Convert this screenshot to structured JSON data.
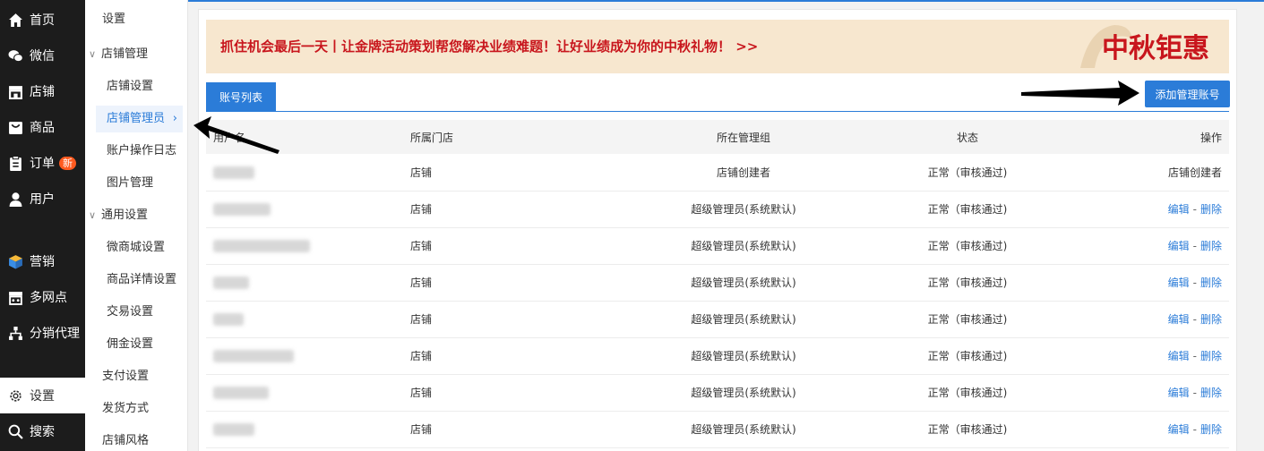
{
  "nav": {
    "home": "首页",
    "wechat": "微信",
    "shop": "店铺",
    "goods": "商品",
    "orders": "订单",
    "orders_badge": "新",
    "users": "用户",
    "marketing": "营销",
    "multi_outlet": "多网点",
    "distribution": "分销代理",
    "settings": "设置",
    "search": "搜索"
  },
  "subnav": {
    "title": "设置",
    "shop_management": "店铺管理",
    "shop_settings": "店铺设置",
    "shop_admins": "店铺管理员",
    "account_log": "账户操作日志",
    "image_management": "图片管理",
    "general_settings": "通用设置",
    "mall_settings": "微商城设置",
    "goods_detail_settings": "商品详情设置",
    "trade_settings": "交易设置",
    "commission_settings": "佣金设置",
    "payment_settings": "支付设置",
    "shipping_methods": "发货方式",
    "shop_style": "店铺风格"
  },
  "banner": {
    "text": "抓住机会最后一天丨让金牌活动策划帮您解决业绩难题！让好业绩成为你的中秋礼物！ >>",
    "art_text": "中秋钜惠"
  },
  "tabs": {
    "active": "账号列表"
  },
  "add_button": "添加管理账号",
  "table": {
    "headers": {
      "name": "用户名",
      "store": "所属门店",
      "group": "所在管理组",
      "status": "状态",
      "action": "操作"
    },
    "rows": [
      {
        "store": "店铺",
        "group": "店铺创建者",
        "status": "正常（审核通过)",
        "action": "店铺创建者"
      },
      {
        "store": "店铺",
        "group": "超级管理员(系统默认)",
        "status": "正常（审核通过)",
        "edit": "编辑",
        "delete": "删除"
      },
      {
        "store": "店铺",
        "group": "超级管理员(系统默认)",
        "status": "正常（审核通过)",
        "edit": "编辑",
        "delete": "删除"
      },
      {
        "store": "店铺",
        "group": "超级管理员(系统默认)",
        "status": "正常（审核通过)",
        "edit": "编辑",
        "delete": "删除"
      },
      {
        "store": "店铺",
        "group": "超级管理员(系统默认)",
        "status": "正常（审核通过)",
        "edit": "编辑",
        "delete": "删除"
      },
      {
        "store": "店铺",
        "group": "超级管理员(系统默认)",
        "status": "正常（审核通过)",
        "edit": "编辑",
        "delete": "删除"
      },
      {
        "store": "店铺",
        "group": "超级管理员(系统默认)",
        "status": "正常（审核通过)",
        "edit": "编辑",
        "delete": "删除"
      },
      {
        "store": "店铺",
        "group": "超级管理员(系统默认)",
        "status": "正常（审核通过)",
        "edit": "编辑",
        "delete": "删除"
      }
    ]
  },
  "colors": {
    "accent": "#2b7cd8",
    "banner_bg": "#f7e7cf",
    "banner_text": "#c8161d",
    "sidebar_bg": "#1c1c1c",
    "badge": "#ff5a1f"
  }
}
